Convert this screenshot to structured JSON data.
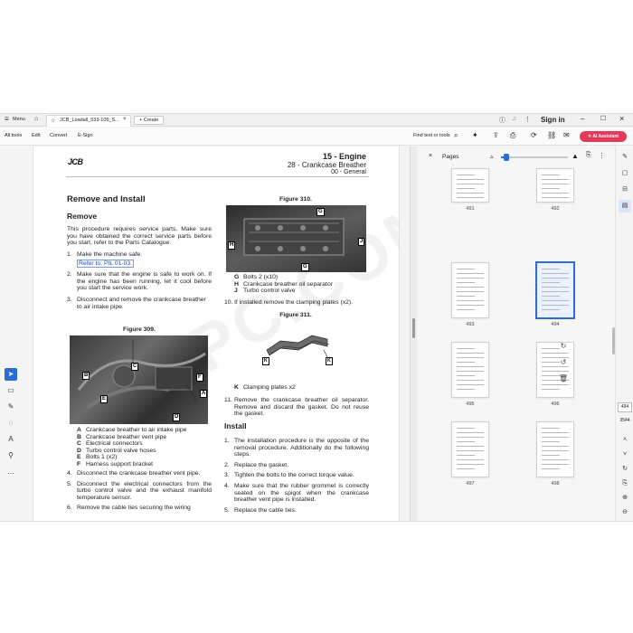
{
  "titlebar": {
    "menu_label": "Menu",
    "tab_title": "JCB_Loadall_533-105_S...",
    "create_label": "Create",
    "signin_label": "Sign in"
  },
  "toolbar": {
    "all_tools": "All tools",
    "edit": "Edit",
    "convert": "Convert",
    "esign": "E-Sign",
    "find_label": "Find text or tools",
    "ai_label": "AI Assistant"
  },
  "document": {
    "logo": "JCB",
    "watermark": "EPC.COM",
    "header_section": "15 - Engine",
    "header_subsection": "28 - Crankcase Breather",
    "header_general": "00 - General",
    "title": "Remove and Install",
    "remove_heading": "Remove",
    "intro": "This procedure requires service parts. Make sure you have obtained the correct service parts before you start, refer to the Parts Catalogue.",
    "step1": "Make the machine safe.",
    "step1_ref": "Refer to: PIL 01-03.",
    "step2": "Make sure that the engine is safe to work on. If the engine has been running, let it cool before you start the service work.",
    "step3": "Disconnect and remove the crankcase breather to air intake pipe.",
    "fig309": "Figure 309.",
    "fig309_legend": [
      {
        "k": "A",
        "v": "Crankcase breather to air intake pipe"
      },
      {
        "k": "B",
        "v": "Crankcase breather vent pipe"
      },
      {
        "k": "C",
        "v": "Electrical connectors"
      },
      {
        "k": "D",
        "v": "Turbo control valve hoses"
      },
      {
        "k": "E",
        "v": "Bolts 1 (x2)"
      },
      {
        "k": "F",
        "v": "Harness support bracket"
      }
    ],
    "step4": "Disconnect the crankcase breather vent pipe.",
    "step5": "Disconnect the electrical connectors from the turbo control valve and the exhaust manifold temperature sensor.",
    "step6": "Remove the cable ties securing the wiring",
    "fig310": "Figure 310.",
    "fig310_legend": [
      {
        "k": "G",
        "v": "Bolts 2 (x10)"
      },
      {
        "k": "H",
        "v": "Crankcase breather oil separator"
      },
      {
        "k": "J",
        "v": "Turbo control valve"
      }
    ],
    "step10": "If installed remove the clamping plates (x2).",
    "fig311": "Figure 311.",
    "fig311_legend": [
      {
        "k": "K",
        "v": "Clamping plates x2"
      }
    ],
    "step11": "Remove the crankcase breather oil separator. Remove and discard the gasket. Do not reuse the gasket.",
    "install_heading": "Install",
    "inst1": "The installation procedure is the opposite of the removal procedure. Additionally do the following steps.",
    "inst2": "Replace the gasket.",
    "inst3": "Tighten the bolts to the correct torque value.",
    "inst4": "Make sure that the rubber grommet is correctly seated on the spigot when the crankcase breather vent pipe is installed.",
    "inst5": "Replace the cable ties."
  },
  "pages_panel": {
    "title": "Pages",
    "thumbs": [
      "491",
      "492",
      "493",
      "494",
      "495",
      "496",
      "497",
      "498"
    ],
    "selected": "494"
  },
  "rail": {
    "page_current": "494",
    "page_total": "3544"
  },
  "colors": {
    "accent": "#2c6ad6",
    "ai_button": "#e23b5a"
  }
}
